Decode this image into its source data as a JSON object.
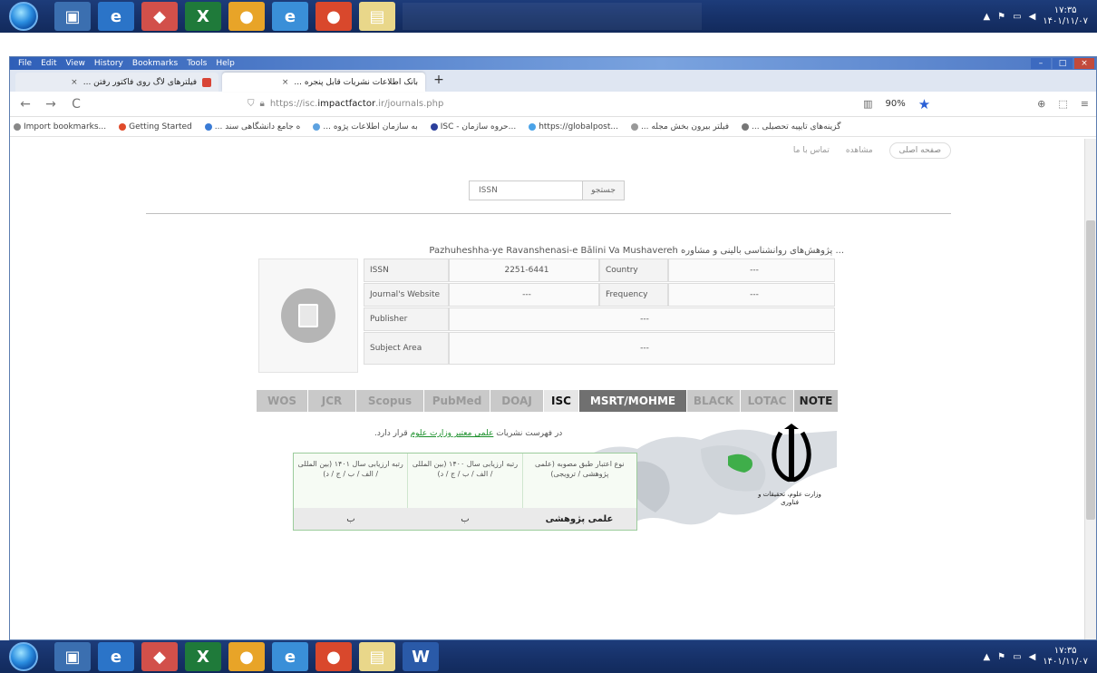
{
  "window": {
    "menu": [
      "File",
      "Edit",
      "View",
      "History",
      "Bookmarks",
      "Tools",
      "Help"
    ]
  },
  "tabs": [
    {
      "label": "فیلترهای لاگ روی فاکتور رفتن ...",
      "close": "×"
    },
    {
      "label": "بانک اطلاعات نشریات قابل پنجره ...",
      "close": "×"
    }
  ],
  "new_tab": "+",
  "nav": {
    "back": "←",
    "forward": "→",
    "reload": "C",
    "url_prefix": "https://isc.",
    "url_host": "impactfactor",
    "url_suffix": ".ir/journals.php",
    "zoom": "90%",
    "star": "★",
    "extras": [
      "⊕",
      "⬚",
      "≡"
    ]
  },
  "bookmarks": [
    "Import bookmarks...",
    "Getting Started",
    "... ه جامع دانشگاهی سند",
    "... به سازمان اطلاعات پژوه",
    "ISC - حروه سازمان...",
    "https://globalpost...",
    "... فیلتر بیرون بخش مجله",
    "... گزینه‌های تایپیه تحصیلی"
  ],
  "site_nav": {
    "home": "صفحه اصلی",
    "item2": "مشاهده",
    "item3": "تماس با ما"
  },
  "search": {
    "value": "ISSN",
    "button": "جستجو"
  },
  "journal": {
    "title": "Pazhuheshha-ye Ravanshenasi-e Bālini Va Mushavereh پژوهش‌های روانشناسی بالینی و مشاوره ...",
    "rows": [
      {
        "label1": "ISSN",
        "value1": "2251-6441",
        "label2": "Country",
        "value2": "---"
      },
      {
        "label1": "Journal's Website",
        "value1": "---",
        "label2": "Frequency",
        "value2": "---"
      },
      {
        "label1": "Publisher",
        "value1": "---"
      },
      {
        "label1": "Subject Area",
        "value1": "---"
      }
    ]
  },
  "db_tabs": [
    "WOS",
    "JCR",
    "Scopus",
    "PubMed",
    "DOAJ",
    "ISC",
    "MSRT/MOHME",
    "BLACK",
    "LOTAC",
    "NOTE"
  ],
  "msrt": {
    "status_prefix": "در فهرست نشریات ",
    "status_link": "علمی معتبر وزارت علوم",
    "status_suffix": " قرار دارد.",
    "table_headers": [
      "رتبه ارزیابی سال ۱۴۰۱ (بین المللی / الف / ب / ج / د)",
      "رتبه ارزیابی سال ۱۴۰۰ (بین المللی / الف / ب / ج / د)",
      "نوع اعتبار طبق مصوبه (علمی پژوهشی / ترویجی)"
    ],
    "table_values": [
      "ب",
      "ب",
      "علمی پژوهشی"
    ],
    "emblem_caption": "وزارت علوم، تحقیقات و فناوری"
  },
  "taskbar": {
    "clock_time": "۱۷:۳۵",
    "clock_date": "۱۴۰۱/۱۱/۰۷"
  }
}
